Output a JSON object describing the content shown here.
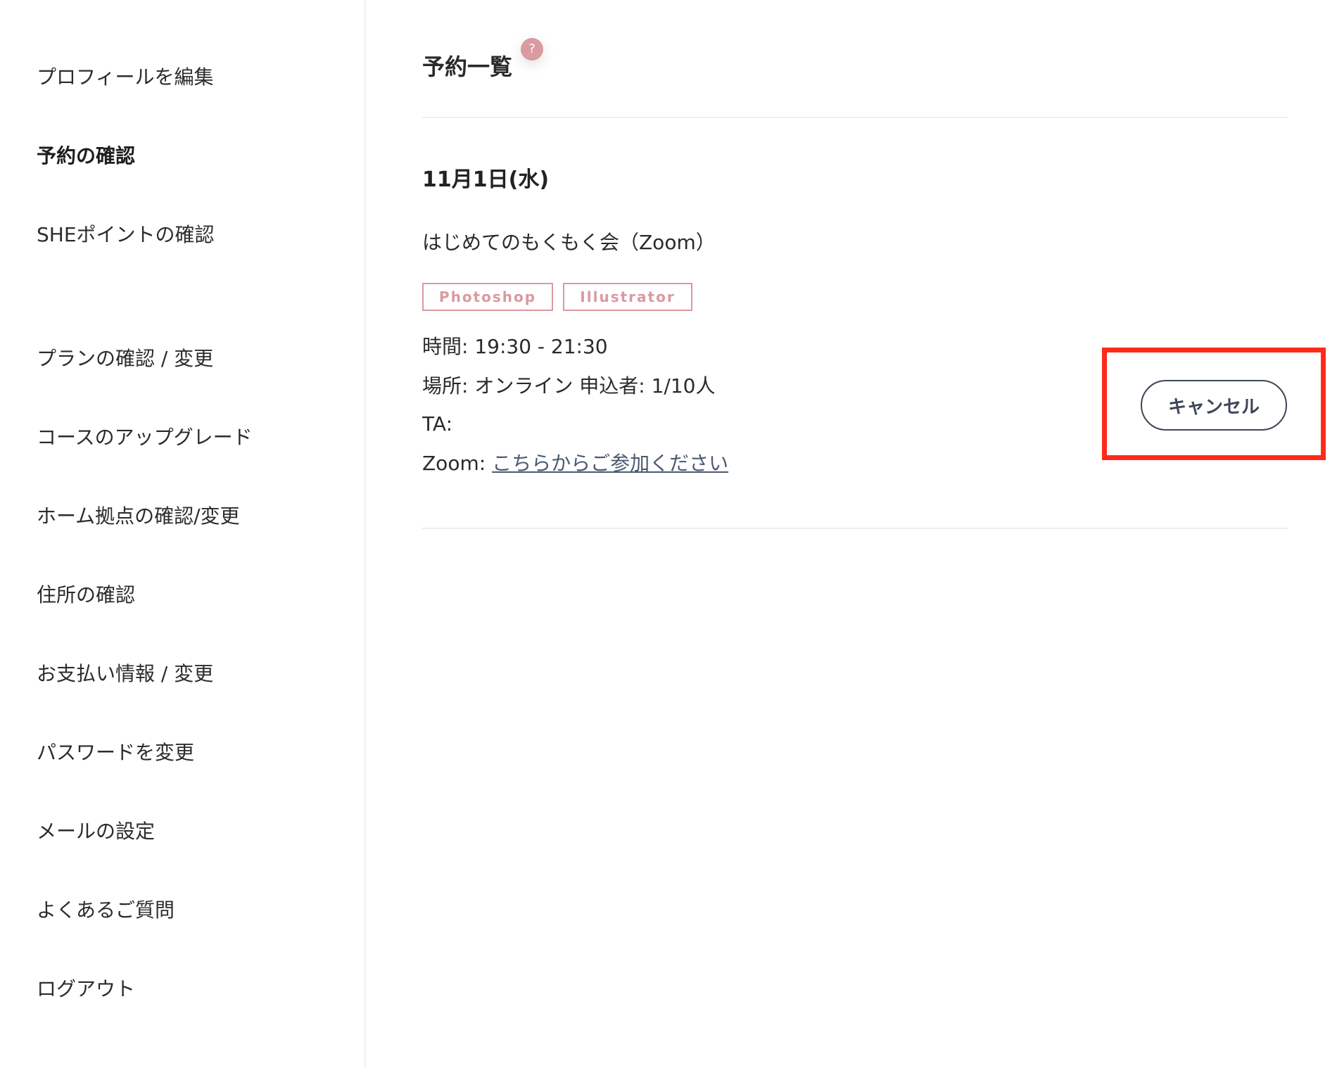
{
  "sidebar": {
    "items": [
      {
        "label": "プロフィールを編集"
      },
      {
        "label": "予約の確認"
      },
      {
        "label": "SHEポイントの確認"
      },
      {
        "label": "プランの確認 / 変更"
      },
      {
        "label": "コースのアップグレード"
      },
      {
        "label": "ホーム拠点の確認/変更"
      },
      {
        "label": "住所の確認"
      },
      {
        "label": "お支払い情報 / 変更"
      },
      {
        "label": "パスワードを変更"
      },
      {
        "label": "メールの設定"
      },
      {
        "label": "よくあるご質問"
      },
      {
        "label": "ログアウト"
      }
    ],
    "active_item": "予約の確認"
  },
  "main": {
    "title": "予約一覧",
    "help_badge": "?",
    "reservation": {
      "date": "11月1日(水)",
      "title": "はじめてのもくもく会（Zoom）",
      "tags": [
        "Photoshop",
        "Illustrator"
      ],
      "time": "時間: 19:30 - 21:30",
      "place": "場所: オンライン 申込者: 1/10人",
      "ta": "TA:",
      "zoom_label": "Zoom: ",
      "zoom_link": "こちらからご参加ください",
      "cancel_label": "キャンセル"
    }
  },
  "colors": {
    "accent_pink": "#d99aa0",
    "button_border": "#3c4756",
    "highlight": "#ff2a1a"
  }
}
